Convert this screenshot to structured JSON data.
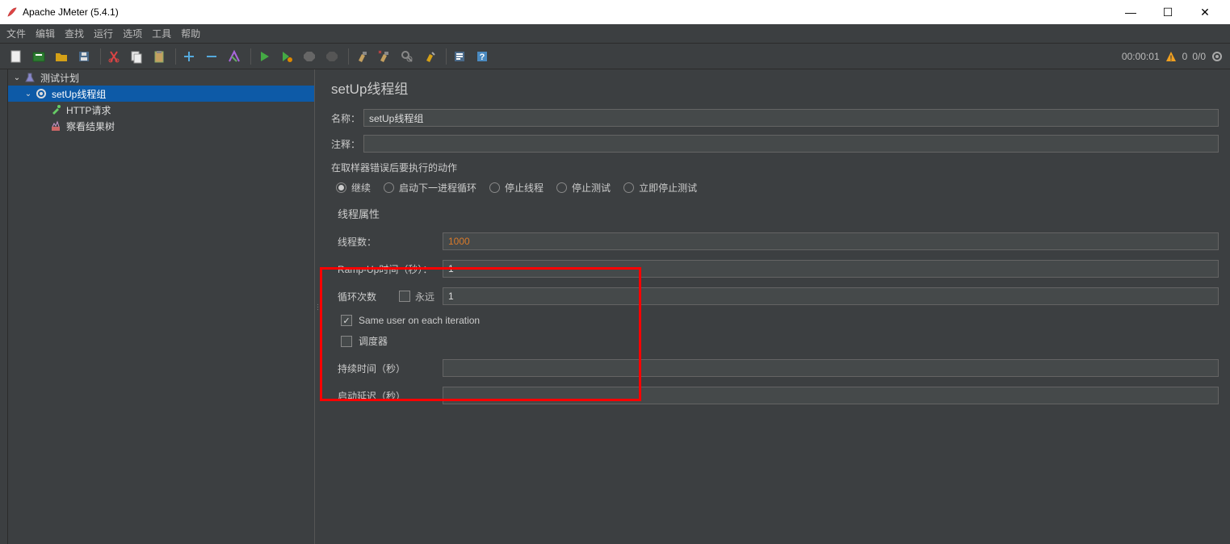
{
  "window": {
    "title": "Apache JMeter (5.4.1)"
  },
  "menu": {
    "file": "文件",
    "edit": "编辑",
    "search": "查找",
    "run": "运行",
    "options": "选项",
    "tools": "工具",
    "help": "帮助"
  },
  "status": {
    "timer": "00:00:01",
    "warn_count": "0",
    "threads": "0/0"
  },
  "tree": {
    "plan": "测试计划",
    "setup": "setUp线程组",
    "http": "HTTP请求",
    "results": "察看结果树"
  },
  "panel": {
    "title": "setUp线程组",
    "name_label": "名称：",
    "name_value": "setUp线程组",
    "comment_label": "注释：",
    "comment_value": "",
    "on_error_label": "在取样器错误后要执行的动作",
    "radios": {
      "r1": "继续",
      "r2": "启动下一进程循环",
      "r3": "停止线程",
      "r4": "停止测试",
      "r5": "立即停止测试"
    },
    "thread_props_title": "线程属性",
    "threads_label": "线程数：",
    "threads_value": "1000",
    "rampup_label": "Ramp-Up时间（秒）：",
    "rampup_value": "1",
    "loop_label": "循环次数",
    "forever_label": "永远",
    "loop_value": "1",
    "same_user_label": "Same user on each iteration",
    "scheduler_label": "调度器",
    "duration_label": "持续时间（秒）",
    "duration_value": "",
    "delay_label": "启动延迟（秒）",
    "delay_value": ""
  }
}
